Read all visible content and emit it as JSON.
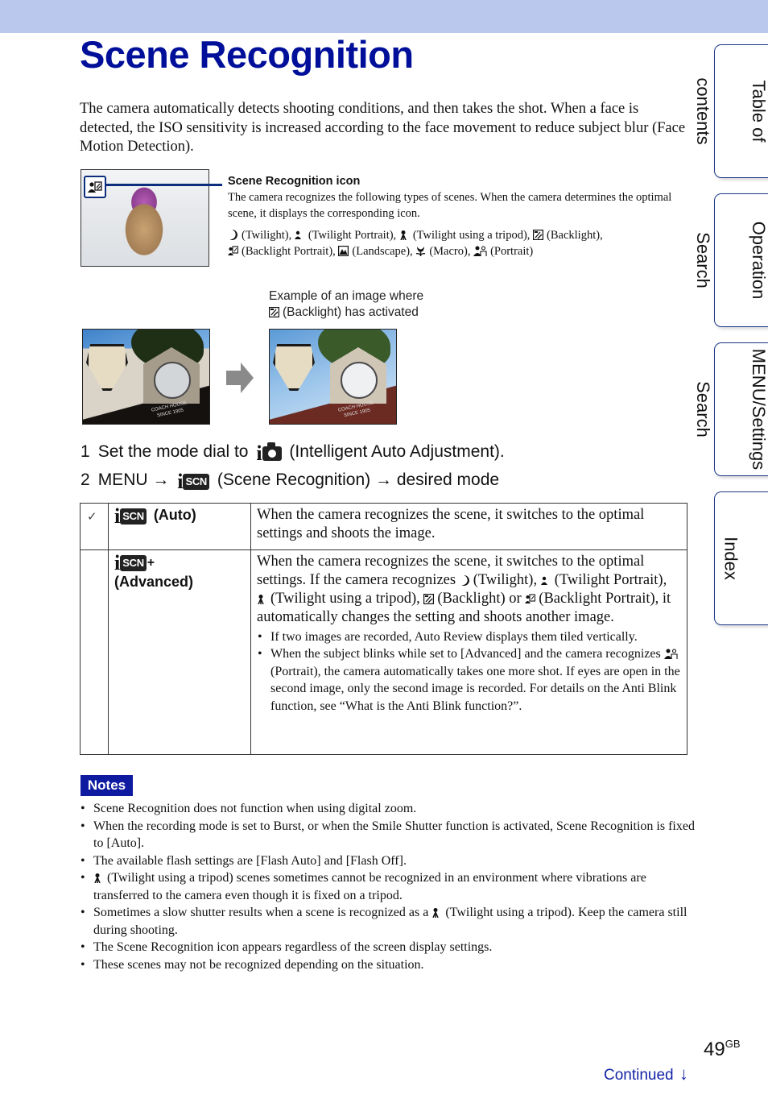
{
  "page": {
    "title": "Scene Recognition",
    "intro": "The camera automatically detects shooting conditions, and then takes the shot. When a face is detected, the ISO sensitivity is increased according to the face movement to reduce subject blur (Face Motion Detection).",
    "header_color": "#b9c8ec",
    "title_color": "#000f99"
  },
  "side_tabs": [
    {
      "lines": [
        "Table of",
        "contents"
      ]
    },
    {
      "lines": [
        "Operation",
        "Search"
      ]
    },
    {
      "lines": [
        "MENU/Settings",
        "Search"
      ]
    },
    {
      "lines": [
        "Index"
      ]
    }
  ],
  "callout": {
    "heading": "Scene Recognition icon",
    "body": "The camera recognizes the following types of scenes. When the camera determines the optimal scene, it displays the corresponding icon.",
    "scenes": [
      {
        "icon": "twilight-icon",
        "label": "(Twilight),"
      },
      {
        "icon": "twilight-portrait-icon",
        "label": "(Twilight Portrait),"
      },
      {
        "icon": "twilight-tripod-icon",
        "label": "(Twilight using a tripod),"
      },
      {
        "icon": "backlight-icon",
        "label": "(Backlight),"
      },
      {
        "icon": "backlight-portrait-icon",
        "label": "(Backlight Portrait),"
      },
      {
        "icon": "landscape-icon",
        "label": "(Landscape),"
      },
      {
        "icon": "macro-icon",
        "label": "(Macro),"
      },
      {
        "icon": "portrait-icon",
        "label": "(Portrait)"
      }
    ]
  },
  "example": {
    "caption_line1": "Example of an image where",
    "caption_line2": "(Backlight) has activated",
    "sign_text_1": "COACH HOUSE",
    "sign_text_2": "SINCE 1905"
  },
  "steps": [
    {
      "num": "1",
      "pre": "Set the mode dial to",
      "post": "(Intelligent Auto Adjustment)."
    },
    {
      "num": "2",
      "pre": "MENU",
      "arrow": "→",
      "mid": "(Scene Recognition)",
      "post": "desired mode"
    }
  ],
  "logo": {
    "i": "i",
    "scn": "SCN",
    "plus": "+"
  },
  "modes_table": {
    "rows": [
      {
        "default_mark": "✓",
        "name": "(Auto)",
        "desc": "When the camera recognizes the scene, it switches to the optimal settings and shoots the image."
      },
      {
        "default_mark": "",
        "name": "(Advanced)",
        "desc_part1": "When the camera recognizes the scene, it switches to the optimal settings. If the camera recognizes",
        "desc_twilight": "(Twilight),",
        "desc_twilight_portrait": "(Twilight Portrait),",
        "desc_tripod": "(Twilight using a tripod),",
        "desc_backlight": "(Backlight) or",
        "desc_backlight_portrait": "(Backlight Portrait), it automatically changes the setting and shoots another image.",
        "bullets": {
          "b1": "If two images are recorded, Auto Review displays them tiled vertically.",
          "b2_pre": "When the subject blinks while set to [Advanced] and the camera recognizes",
          "b2_post": "(Portrait), the camera automatically takes one more shot. If eyes are open in the second image, only the second image is recorded. For details on the Anti Blink function, see “What is the Anti Blink function?”."
        }
      }
    ]
  },
  "notes": {
    "label": "Notes",
    "badge_color": "#0e1aa0",
    "items": [
      "Scene Recognition does not function when using digital zoom.",
      "When the recording mode is set to Burst, or when the Smile Shutter function is activated, Scene Recognition is fixed to [Auto].",
      "The available flash settings are [Flash Auto] and [Flash Off].",
      "(Twilight using a tripod) scenes sometimes cannot be recognized in an environment where vibrations are transferred to the camera even though it is fixed on a tripod.",
      "Sometimes a slow shutter results when a scene is recognized as a",
      "(Twilight using a tripod). Keep the camera still during shooting.",
      "The Scene Recognition icon appears regardless of the screen display settings.",
      "These scenes may not be recognized depending on the situation."
    ]
  },
  "footer": {
    "page_number": "49",
    "page_suffix": "GB",
    "continued": "Continued",
    "continued_arrow": "↓"
  }
}
